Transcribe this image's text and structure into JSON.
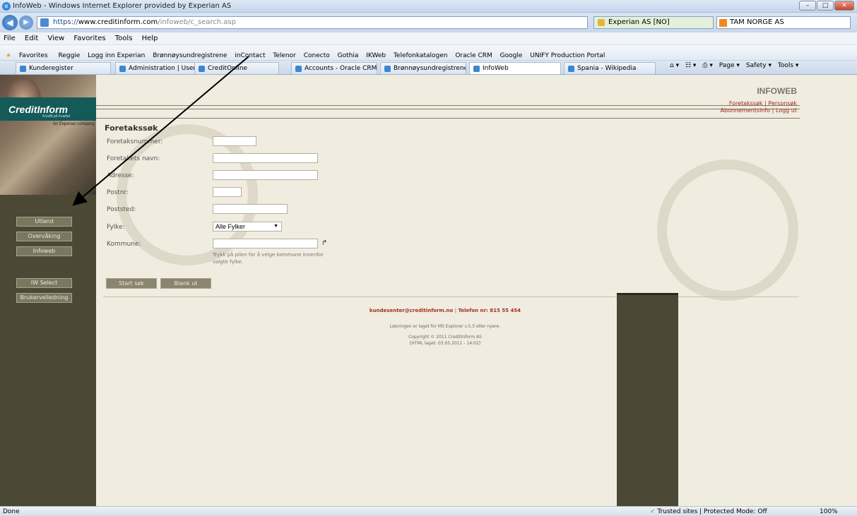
{
  "window": {
    "title": "InfoWeb - Windows Internet Explorer provided by Experian AS",
    "minimize": "–",
    "maximize": "□",
    "close": "✕"
  },
  "address": {
    "url_prefix": "https://",
    "url_host": "www.creditinform.com",
    "url_path": "/infoweb/c_search.asp",
    "certificate": "Experian AS [NO]",
    "search_provider": "TAM NORGE AS",
    "back_icon": "arrow-left-icon",
    "forward_icon": "arrow-right-icon"
  },
  "menu": [
    "File",
    "Edit",
    "View",
    "Favorites",
    "Tools",
    "Help"
  ],
  "favorites": {
    "label": "Favorites",
    "items": [
      "Reggie",
      "Logg inn Experian",
      "Brønnøysundregistrene",
      "inContact",
      "Telenor",
      "Conecto",
      "Gothia",
      "IKWeb",
      "Telefonkatalogen",
      "Oracle CRM",
      "Google",
      "UNIFY Production Portal"
    ]
  },
  "tabs": [
    {
      "label": "Kunderegister"
    },
    {
      "label": "Administration | User | Inf..."
    },
    {
      "label": "CreditOnline"
    },
    {
      "label": "Accounts - Oracle CRM ..."
    },
    {
      "label": "Brønnøysundregistrene - ..."
    },
    {
      "label": "InfoWeb",
      "active": true
    },
    {
      "label": "Spania - Wikipedia"
    }
  ],
  "command_bar": [
    "Page ▾",
    "Safety ▾",
    "Tools ▾"
  ],
  "sidebar": {
    "logo": "CreditInform",
    "logo_tagline": "Kreditt på Kvalitet",
    "company_note": "An Experian company",
    "buttons": [
      "Utland",
      "Overvåking",
      "Infoweb",
      "IW Select",
      "Brukerveiledning"
    ]
  },
  "header": {
    "brand": "INFOWEB",
    "link_foretakssok": "Foretakssøk",
    "link_personsok": "Personsøk",
    "link_abonnement": "Abonnementsinfo",
    "link_loggut": "Logg ut",
    "separator": "|"
  },
  "form": {
    "title": "Foretakssøk",
    "fields": {
      "foretaksnummer": "Foretaksnummer:",
      "navn": "Foretakets navn:",
      "adresse": "Adresse:",
      "postnr": "Postnr:",
      "poststed": "Poststed:",
      "fylke": "Fylke:",
      "kommune": "Kommune:"
    },
    "fylke_selected": "Alle Fylker",
    "hint": "Trykk på pilen for å velge kommune innenfor valgte fylke.",
    "start_button": "Start søk",
    "blank_button": "Blank ut"
  },
  "footer": {
    "email": "kundesenter@creditinform.no",
    "separator": "|",
    "phone": "Telefon nr: 815 55 454",
    "browser_note": "Løsningen er laget for MS Explorer v.5.5 eller nyere.",
    "copyright": "Copyright © 2011 CreditInform AS",
    "html_date": "[HTML laget: 03.05.2011 - 14:02]"
  },
  "status": {
    "left": "Done",
    "zone": "Trusted sites | Protected Mode: Off",
    "zoom": "100%"
  }
}
